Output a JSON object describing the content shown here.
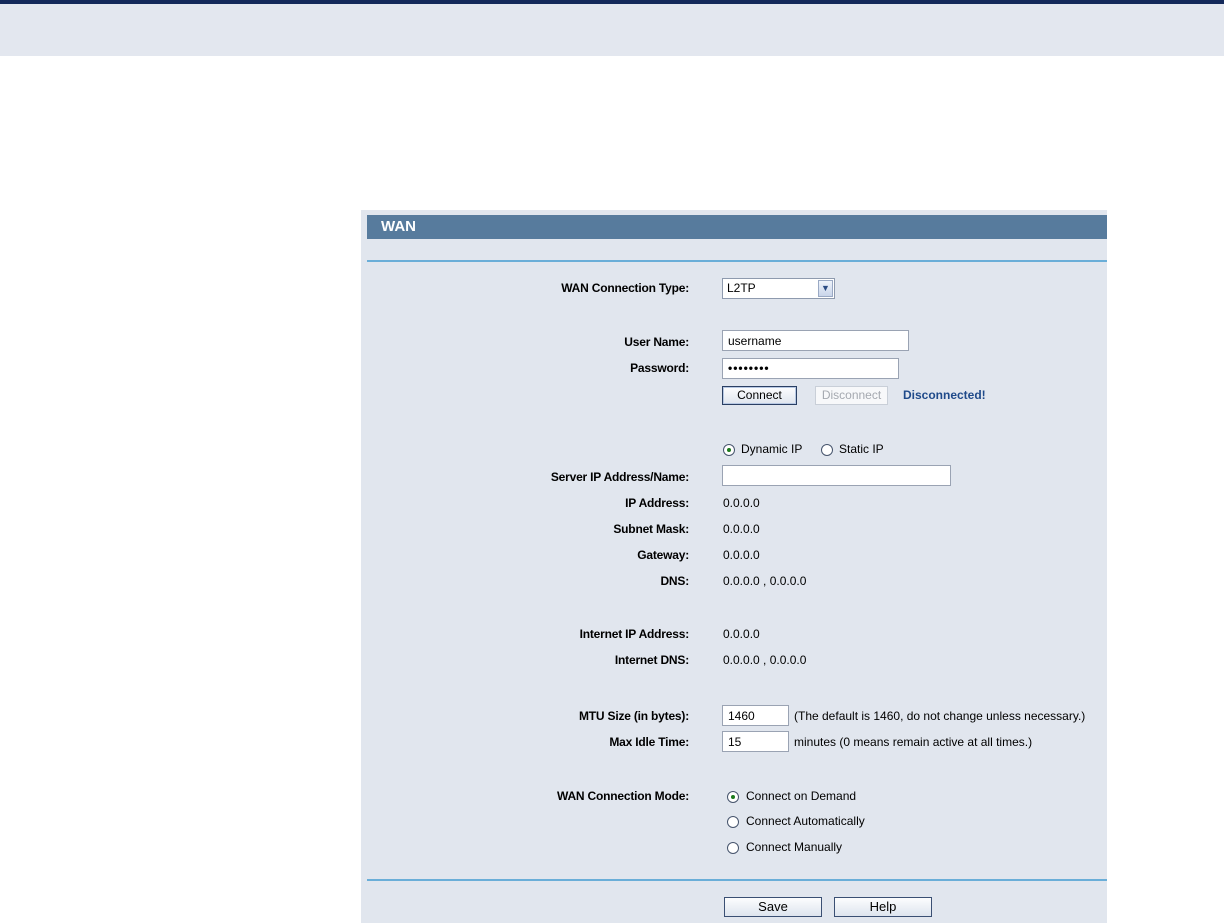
{
  "panel": {
    "title": "WAN"
  },
  "connection_type": {
    "label": "WAN Connection Type:",
    "selected": "L2TP"
  },
  "user_name": {
    "label": "User Name:",
    "value": "username"
  },
  "password": {
    "label": "Password:",
    "value": "••••••••"
  },
  "buttons": {
    "connect": "Connect",
    "disconnect": "Disconnect",
    "save": "Save",
    "help": "Help"
  },
  "status": "Disconnected!",
  "ip_mode": {
    "options": [
      "Dynamic IP",
      "Static IP"
    ],
    "selected": "Dynamic IP"
  },
  "server": {
    "label": "Server IP Address/Name:",
    "value": ""
  },
  "ip_info": {
    "ip_address": {
      "label": "IP Address:",
      "value": "0.0.0.0"
    },
    "subnet_mask": {
      "label": "Subnet Mask:",
      "value": "0.0.0.0"
    },
    "gateway": {
      "label": "Gateway:",
      "value": "0.0.0.0"
    },
    "dns": {
      "label": "DNS:",
      "value": "0.0.0.0 , 0.0.0.0"
    }
  },
  "internet": {
    "ip": {
      "label": "Internet IP Address:",
      "value": "0.0.0.0"
    },
    "dns": {
      "label": "Internet DNS:",
      "value": "0.0.0.0 , 0.0.0.0"
    }
  },
  "mtu": {
    "label": "MTU Size (in bytes):",
    "value": "1460",
    "hint": "(The default is 1460, do not change unless necessary.)"
  },
  "idle": {
    "label": "Max Idle Time:",
    "value": "15",
    "hint": "minutes (0 means remain active at all times.)"
  },
  "mode": {
    "label": "WAN Connection Mode:",
    "options": [
      "Connect on Demand",
      "Connect Automatically",
      "Connect Manually"
    ],
    "selected": "Connect on Demand"
  },
  "colors": {
    "header": "#577b9d",
    "panel_bg": "#e1e6ee",
    "divider": "#6aaed8",
    "status_text": "#1f4a8a",
    "top_bar": "#13295a"
  }
}
